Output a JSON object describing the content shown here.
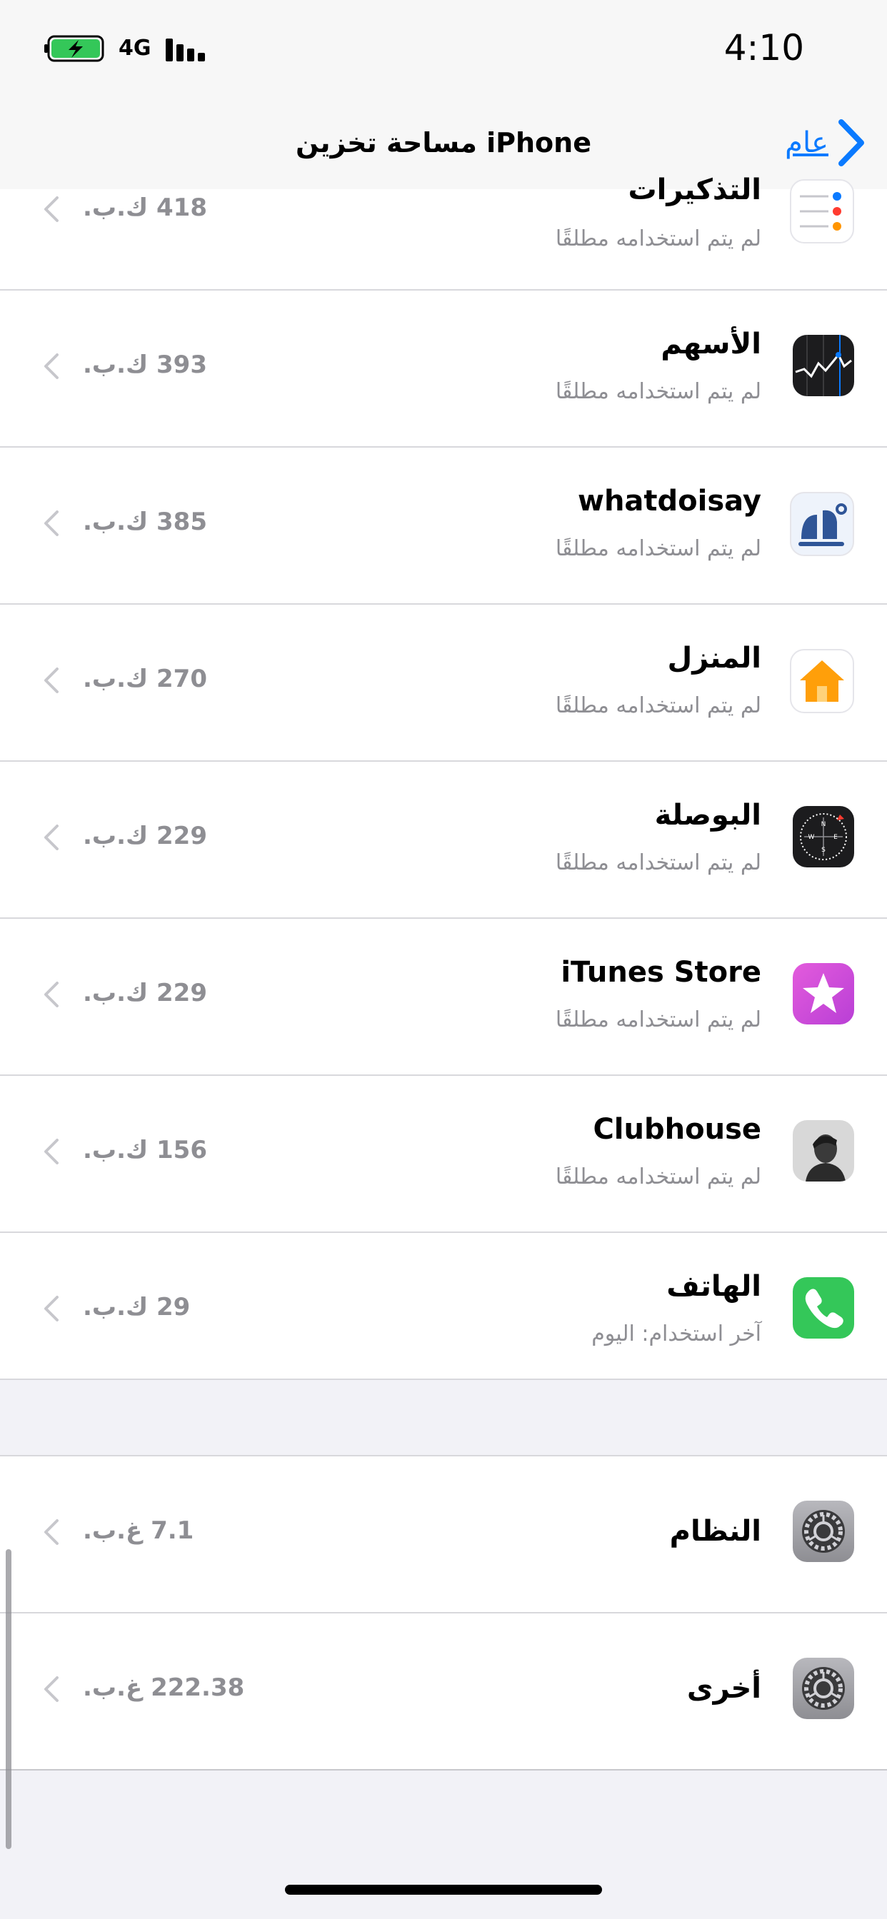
{
  "status": {
    "time": "4:10",
    "network": "4G"
  },
  "nav": {
    "title": "مساحة تخزين iPhone",
    "back_label": "عام"
  },
  "apps": [
    {
      "name": "التذكيرات",
      "subtitle": "لم يتم استخدامه مطلقًا",
      "size": "418 ك.ب.",
      "icon": "reminders-icon"
    },
    {
      "name": "الأسهم",
      "subtitle": "لم يتم استخدامه مطلقًا",
      "size": "393 ك.ب.",
      "icon": "stocks-icon"
    },
    {
      "name": "whatdoisay",
      "subtitle": "لم يتم استخدامه مطلقًا",
      "size": "385 ك.ب.",
      "icon": "whatdoisay-icon"
    },
    {
      "name": "المنزل",
      "subtitle": "لم يتم استخدامه مطلقًا",
      "size": "270 ك.ب.",
      "icon": "home-icon"
    },
    {
      "name": "البوصلة",
      "subtitle": "لم يتم استخدامه مطلقًا",
      "size": "229 ك.ب.",
      "icon": "compass-icon"
    },
    {
      "name": "iTunes Store",
      "subtitle": "لم يتم استخدامه مطلقًا",
      "size": "229 ك.ب.",
      "icon": "itunes-store-icon"
    },
    {
      "name": "Clubhouse",
      "subtitle": "لم يتم استخدامه مطلقًا",
      "size": "156 ك.ب.",
      "icon": "clubhouse-icon"
    },
    {
      "name": "الهاتف",
      "subtitle": "آخر استخدام: اليوم",
      "size": "29 ك.ب.",
      "icon": "phone-icon"
    }
  ],
  "system": [
    {
      "name": "النظام",
      "size": "7.1 غ.ب.",
      "icon": "settings-gear-icon"
    },
    {
      "name": "أخرى",
      "size": "222.38 غ.ب.",
      "icon": "settings-gear-icon"
    }
  ],
  "colors": {
    "accent": "#0a7aff",
    "secondary_text": "#8e8e93",
    "battery_fill": "#34c759"
  }
}
